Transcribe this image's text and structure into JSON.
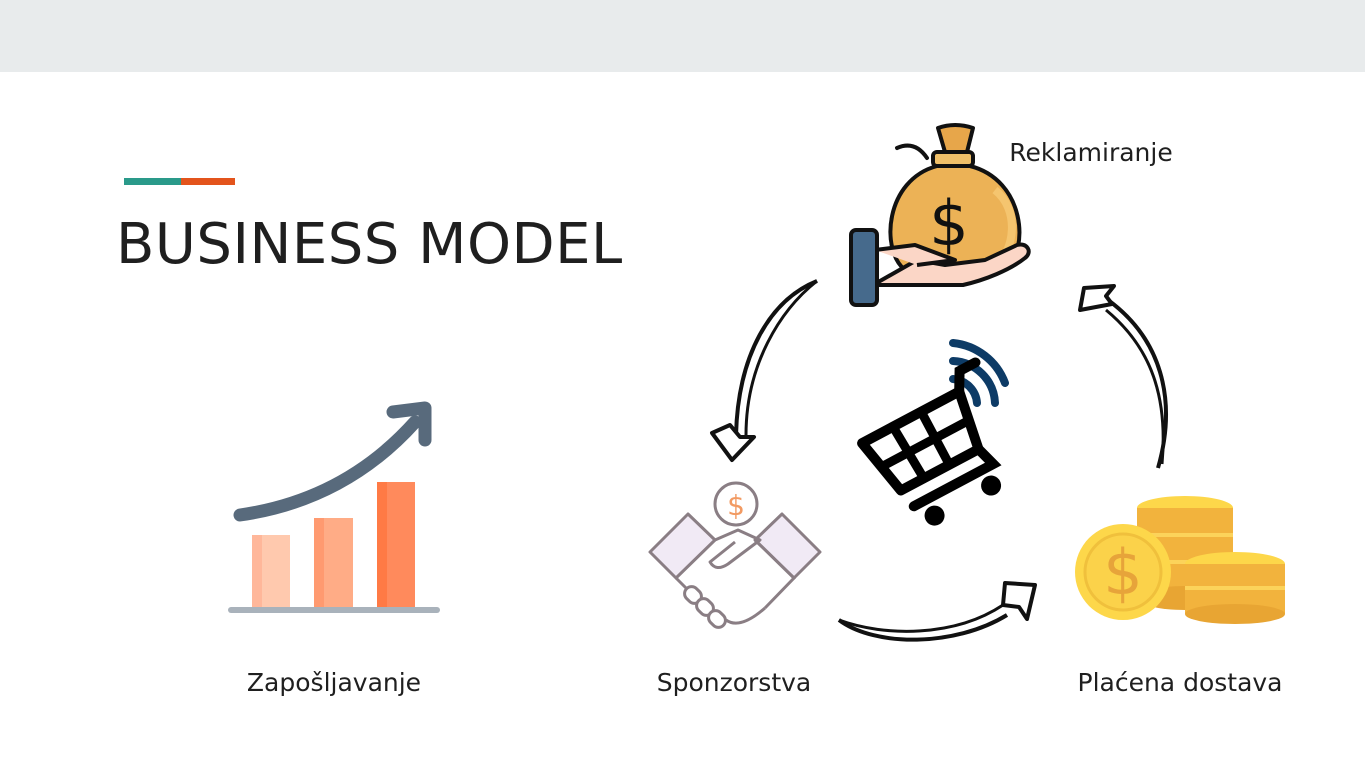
{
  "slide": {
    "title": "BUSINESS MODEL",
    "colors": {
      "accent_teal": "#2a9a8a",
      "accent_orange": "#e3541c",
      "top_bar": "#e8ebec"
    }
  },
  "labels": {
    "advertising": "Reklamiranje",
    "employment": "Zapošljavanje",
    "sponsorships": "Sponzorstva",
    "paid_delivery": "Plaćena dostava"
  },
  "icons": {
    "advertising": "money-bag-hand-icon",
    "employment": "growth-chart-icon",
    "sponsorships": "handshake-dollar-icon",
    "paid_delivery": "coin-stacks-icon",
    "center": "online-shopping-cart-icon"
  }
}
